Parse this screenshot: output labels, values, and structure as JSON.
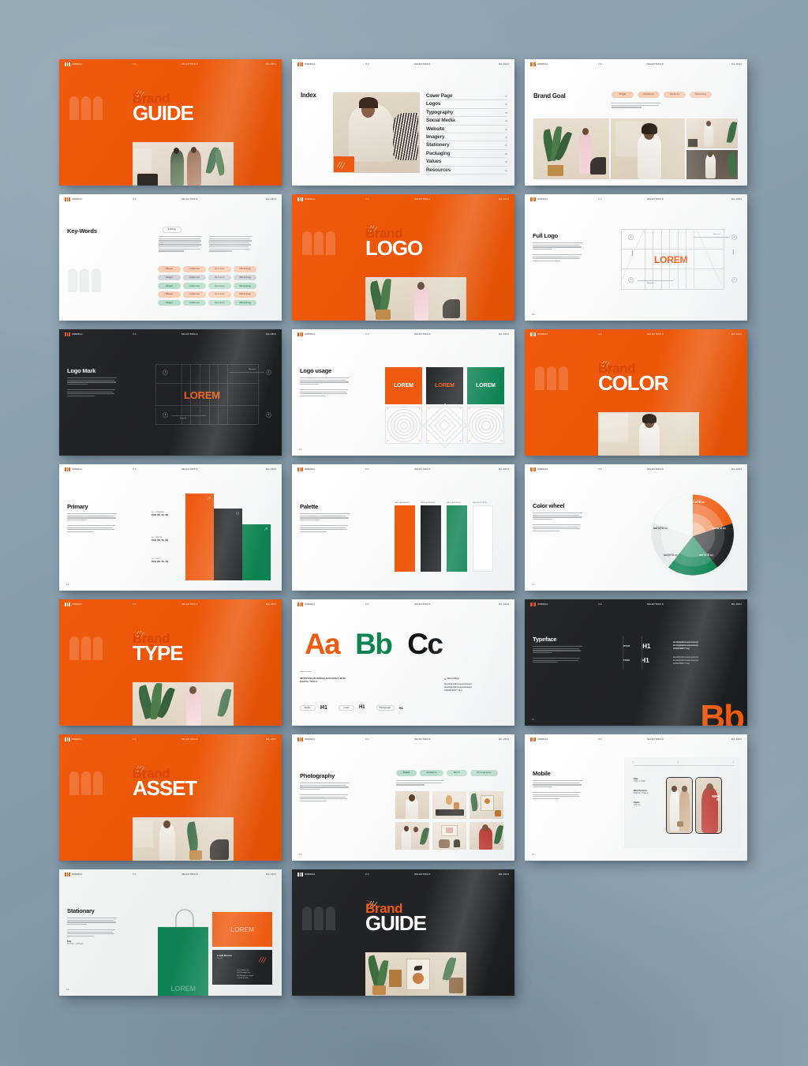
{
  "meta": {
    "brand_mark_label": "MINIMAL",
    "header_version": "V-1",
    "header_selection": "SELECTION-6",
    "header_code": "BG-2024"
  },
  "colors": {
    "orange": "#EE5A10",
    "green": "#0C8350",
    "dark": "#212225",
    "peach": "#F8CDB4",
    "teal": "#B9DDCD",
    "grey": "#D2D5D8",
    "page_bg": "#8FA3B0"
  },
  "slides": [
    {
      "id": "cover-orange",
      "kind": "cover",
      "theme": "orange",
      "brand_word": "Brand",
      "title_word": "GUIDE"
    },
    {
      "id": "index",
      "kind": "index",
      "theme": "light",
      "title": "Index",
      "entries": [
        {
          "label": "Cover Page",
          "page": "01"
        },
        {
          "label": "Logos",
          "page": "02"
        },
        {
          "label": "Typography",
          "page": "03"
        },
        {
          "label": "Social Media",
          "page": "04"
        },
        {
          "label": "Website",
          "page": "05"
        },
        {
          "label": "Imagery",
          "page": "06"
        },
        {
          "label": "Stationery",
          "page": "07"
        },
        {
          "label": "Packaging",
          "page": "08"
        },
        {
          "label": "Values",
          "page": "09"
        },
        {
          "label": "Resources",
          "page": "10"
        }
      ]
    },
    {
      "id": "brand-goal",
      "kind": "brand-goal",
      "theme": "light",
      "title": "Brand Goal",
      "tags": [
        "Target",
        "Audience",
        "Services",
        "Marketing"
      ]
    },
    {
      "id": "key-words",
      "kind": "key-words",
      "theme": "light",
      "title": "Key-Words",
      "listing_label": "Listing",
      "tag_rows": [
        {
          "style": "peach",
          "tags": [
            "Target",
            "Audience",
            "Services",
            "Marketing"
          ]
        },
        {
          "style": "grey",
          "tags": [
            "Target",
            "Audience",
            "Services",
            "Marketing"
          ]
        },
        {
          "style": "teal",
          "tags": [
            "Target",
            "Audience",
            "Services",
            "Marketing"
          ]
        },
        {
          "style": "peach",
          "tags": [
            "Target",
            "Audience",
            "Services",
            "Marketing"
          ]
        },
        {
          "style": "teal",
          "tags": [
            "Target",
            "Audience",
            "Services",
            "Marketing"
          ]
        }
      ]
    },
    {
      "id": "cover-logo",
      "kind": "cover",
      "theme": "orange",
      "brand_word": "Brand",
      "title_word": "LOGO"
    },
    {
      "id": "full-logo",
      "kind": "full-logo",
      "theme": "light",
      "title": "Full Logo",
      "wordmark": "LOREM",
      "measure_labels": [
        "Measure",
        "Height",
        "Width",
        "Baseline"
      ],
      "node_label": "X",
      "page_number": "01"
    },
    {
      "id": "logo-mark",
      "kind": "logo-mark",
      "theme": "dark",
      "title": "Logo Mark",
      "wordmark": "LOREM",
      "measure_labels": [
        "Measure",
        "Legend"
      ],
      "node_label": "X"
    },
    {
      "id": "logo-usage",
      "kind": "logo-usage",
      "theme": "light",
      "title": "Logo usage",
      "swatches": [
        {
          "bg": "#EE5A10",
          "text": "LOREM",
          "text_color": "#FFFFFF"
        },
        {
          "bg": "#222326",
          "text": "LOREM",
          "text_color": "#EE5A10"
        },
        {
          "bg": "#0C8350",
          "text": "LOREM",
          "text_color": "#FFFFFF"
        }
      ],
      "patterns": [
        "concentric-circles",
        "concentric-diamonds",
        "concentric-circles"
      ],
      "corner_mark": "X",
      "page_number": "02"
    },
    {
      "id": "cover-color",
      "kind": "cover",
      "theme": "orange",
      "brand_word": "Brand",
      "title_word": "COLOR"
    },
    {
      "id": "primary",
      "kind": "primary",
      "theme": "light",
      "title": "Primary",
      "entries": [
        {
          "name": "01  /  ORANGE",
          "rgb": "RGB (58, 58, 30)",
          "color": "#EE5A10"
        },
        {
          "name": "02  /  WHITE",
          "rgb": "RGB (58, 58, 30)",
          "color": "#222326"
        },
        {
          "name": "03  /  SOFT",
          "rgb": "RGB (58, 58, 30)",
          "color": "#0C8350"
        }
      ],
      "page_number": "03"
    },
    {
      "id": "palette",
      "kind": "palette",
      "theme": "light",
      "title": "Palette",
      "swatches": [
        {
          "label": "HEX (#EE5A10)",
          "color": "#EE5A10"
        },
        {
          "label": "HEX (#222326)",
          "color": "#222326"
        },
        {
          "label": "HEX (#0C8350)",
          "color": "#0C8350"
        },
        {
          "label": "HEX (#FFFFFF)",
          "color": "#FFFFFF"
        }
      ]
    },
    {
      "id": "color-wheel",
      "kind": "color-wheel",
      "theme": "light",
      "title": "Color wheel",
      "segments": [
        {
          "name": "01  /  BASE",
          "rgb": "RGB (58, 58, 30)",
          "color": "#EE5A10"
        },
        {
          "name": "02  /  DEEP",
          "rgb": "RGB (58, 58, 30)",
          "color": "#222326"
        },
        {
          "name": "03  /  LEAF",
          "rgb": "RGB (58, 58, 30)",
          "color": "#0C8350"
        },
        {
          "name": "04  /  MIST",
          "rgb": "RGB (58, 58, 30)",
          "color": "#E9EBEB"
        },
        {
          "name": "05  /  SNOW",
          "rgb": "RGB (58, 58, 30)",
          "color": "#F7F8F8"
        }
      ],
      "page_number": "04"
    },
    {
      "id": "cover-type",
      "kind": "cover",
      "theme": "orange",
      "brand_word": "Brand",
      "title_word": "TYPE"
    },
    {
      "id": "alphabet",
      "kind": "alphabet",
      "theme": "light",
      "glyphs": [
        {
          "text": "Aa",
          "color": "#EE5A10"
        },
        {
          "text": "Bb",
          "color": "#0C8350"
        },
        {
          "text": "Cc",
          "color": "#111214"
        }
      ],
      "headline": "IMPROVING BUSINESS EFFICIENCY WITH DIGITAL TOOLS",
      "weight_label": "Bold (100pt)",
      "specimen_lines": [
        "abcdefghijklmnopqrstuvwxyz",
        "abcdefghijklmnopqrstuvwxyz",
        "1234567890?!*^&,()"
      ],
      "size_chips": [
        {
          "chip": "Name",
          "sample": "H1"
        },
        {
          "chip": "Lead",
          "sample": "H1"
        },
        {
          "chip": "Paragraph",
          "sample": "H1"
        }
      ]
    },
    {
      "id": "typeface",
      "kind": "typeface",
      "theme": "dark",
      "title": "Typeface",
      "families": [
        {
          "name": "INTER",
          "sample": "H1",
          "lines": [
            "abcdefghijklmnopqrstuvwxyz",
            "abcdefghijklmnopqrstuvwxyz",
            "1234567890?!*^&,()"
          ]
        },
        {
          "name": "WORK",
          "sample": "H1",
          "lines": [
            "abcdefghijklmnopqrstuvwxyz",
            "abcdefghijklmnopqrstuvwxyz",
            "1234567890?!*^&,()"
          ]
        }
      ],
      "big_glyph": "Bb",
      "page_number": "05"
    },
    {
      "id": "cover-asset",
      "kind": "cover",
      "theme": "orange",
      "brand_word": "Brand",
      "title_word": "ASSET"
    },
    {
      "id": "photography",
      "kind": "photography",
      "theme": "light",
      "title": "Photography",
      "tags": [
        "Brand",
        "Audience",
        "Mood",
        "Photography"
      ],
      "page_number": "06"
    },
    {
      "id": "mobile",
      "kind": "mobile",
      "theme": "light",
      "title": "Mobile",
      "specs": [
        {
          "label": "Size",
          "value": "1920 x 1080"
        },
        {
          "label": "Web Devices",
          "value": "Digital 144ppi"
        },
        {
          "label": "Paper",
          "value": "Glossy"
        }
      ],
      "phone_overlay": "NEW\nIN",
      "ruler_marks": [
        "1",
        "2",
        "3"
      ],
      "page_number": "07"
    },
    {
      "id": "stationary",
      "kind": "stationary",
      "theme": "grey",
      "title": "Stationary",
      "size_label": "Size",
      "size_value": "A4 210 x 297mm",
      "bag_word": "LOREM",
      "card_word": "LOREM",
      "business_card": {
        "name": "Linda Brown",
        "role": "Founder",
        "details": [
          "www.example.com",
          "hello@example.com",
          "123 Wilk type str. London",
          "+1 (234) 567-890"
        ]
      },
      "page_number": "08"
    },
    {
      "id": "cover-guide-dark",
      "kind": "cover",
      "theme": "dark",
      "brand_word": "Brand",
      "title_word": "GUIDE"
    }
  ]
}
